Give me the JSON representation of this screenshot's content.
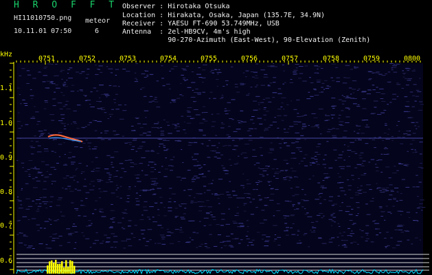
{
  "header": {
    "brand": "H R O F F T",
    "filename": "HI11010750.png",
    "datetime": "10.11.01 07:50",
    "meteor_label": "meteor",
    "meteor_count": "6"
  },
  "station": {
    "observer": "Observer : Hirotaka Otsuka",
    "location": "Location : Hirakata, Osaka, Japan (135.7E, 34.9N)",
    "receiver": "Receiver : YAESU FT-690 53.749MHz, USB",
    "antenna": "Antenna  : 2el-HB9CV, 4m's high",
    "antenna_detail": "           90-270-Azimuth (East-West), 90-Elevation (Zenith)"
  },
  "axes": {
    "freq_unit": "kHz",
    "time_labels": [
      "0751",
      "0752",
      "0753",
      "0754",
      "0755",
      "0756",
      "0757",
      "0758",
      "0759",
      "0800"
    ],
    "freq_labels": [
      "1.1",
      "1.0",
      "0.9",
      "0.8",
      "0.7",
      "0.6"
    ]
  },
  "colors": {
    "brand": "#19d36b",
    "axis_labels": "#ffff00",
    "spectrum": "#00e5ff",
    "noise_bg": "#0b0b3a"
  }
}
